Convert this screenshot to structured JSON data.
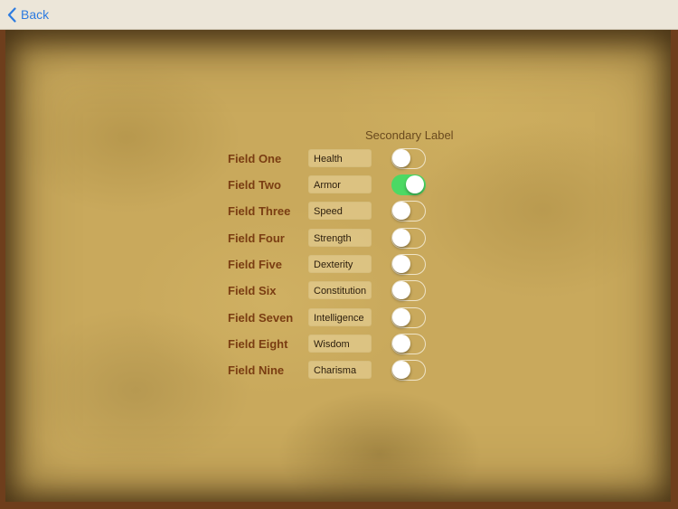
{
  "navbar": {
    "back_label": "Back"
  },
  "form": {
    "secondary_label": "Secondary Label",
    "rows": [
      {
        "label": "Field One",
        "value": "Health",
        "toggle_on": false
      },
      {
        "label": "Field Two",
        "value": "Armor",
        "toggle_on": true
      },
      {
        "label": "Field Three",
        "value": "Speed",
        "toggle_on": false
      },
      {
        "label": "Field Four",
        "value": "Strength",
        "toggle_on": false
      },
      {
        "label": "Field Five",
        "value": "Dexterity",
        "toggle_on": false
      },
      {
        "label": "Field Six",
        "value": "Constitution",
        "toggle_on": false
      },
      {
        "label": "Field Seven",
        "value": "Intelligence",
        "toggle_on": false
      },
      {
        "label": "Field Eight",
        "value": "Wisdom",
        "toggle_on": false
      },
      {
        "label": "Field Nine",
        "value": "Charisma",
        "toggle_on": false
      }
    ]
  },
  "colors": {
    "accent": "#2d7be0",
    "toggle_on": "#4cd964",
    "field_label": "#7a3d12",
    "parchment": "#c9a95c"
  }
}
